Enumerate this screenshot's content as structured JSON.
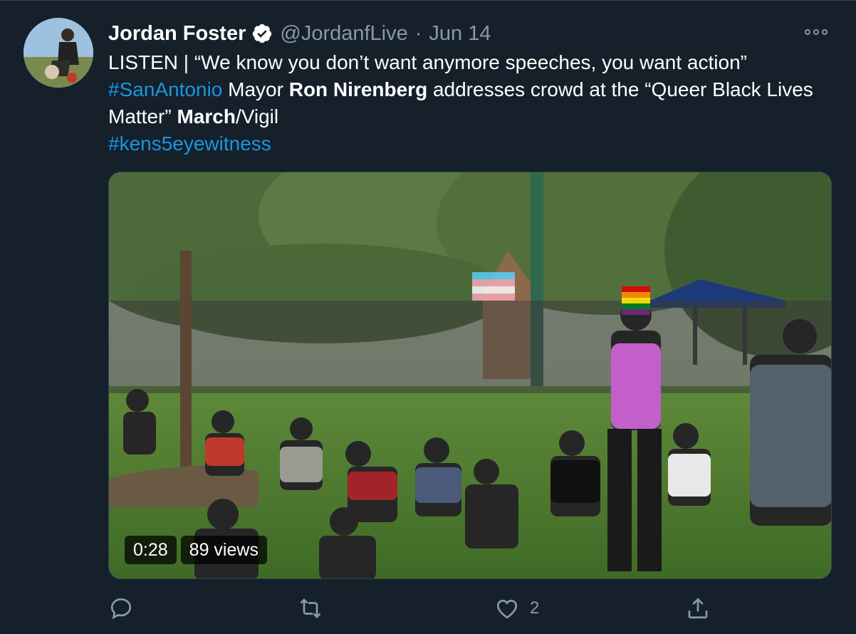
{
  "tweet": {
    "author_name": "Jordan Foster",
    "handle": "@JordanfLive",
    "separator": "·",
    "date": "Jun 14",
    "text": {
      "line1": "LISTEN | “We know you don’t want anymore speeches, you want action”",
      "hashtag_city": "#SanAntonio",
      "mayor_prefix": " Mayor ",
      "mayor_name": "Ron Nirenberg",
      "mid": " addresses crowd at the “Queer Black Lives Matter” ",
      "march": "March",
      "vigil": "/Vigil",
      "hashtag_station": "#kens5eyewitness"
    },
    "video": {
      "duration": "0:28",
      "views": "89 views"
    },
    "actions": {
      "reply_count": "",
      "retweet_count": "",
      "like_count": "2"
    }
  },
  "colors": {
    "background": "#15202b",
    "text": "#ffffff",
    "muted": "#8899a6",
    "link": "#1b95e0",
    "border": "#38444d"
  },
  "icons": {
    "verified": "verified-badge-icon",
    "more": "more-icon",
    "reply": "reply-icon",
    "retweet": "retweet-icon",
    "like": "heart-icon",
    "share": "share-icon"
  }
}
